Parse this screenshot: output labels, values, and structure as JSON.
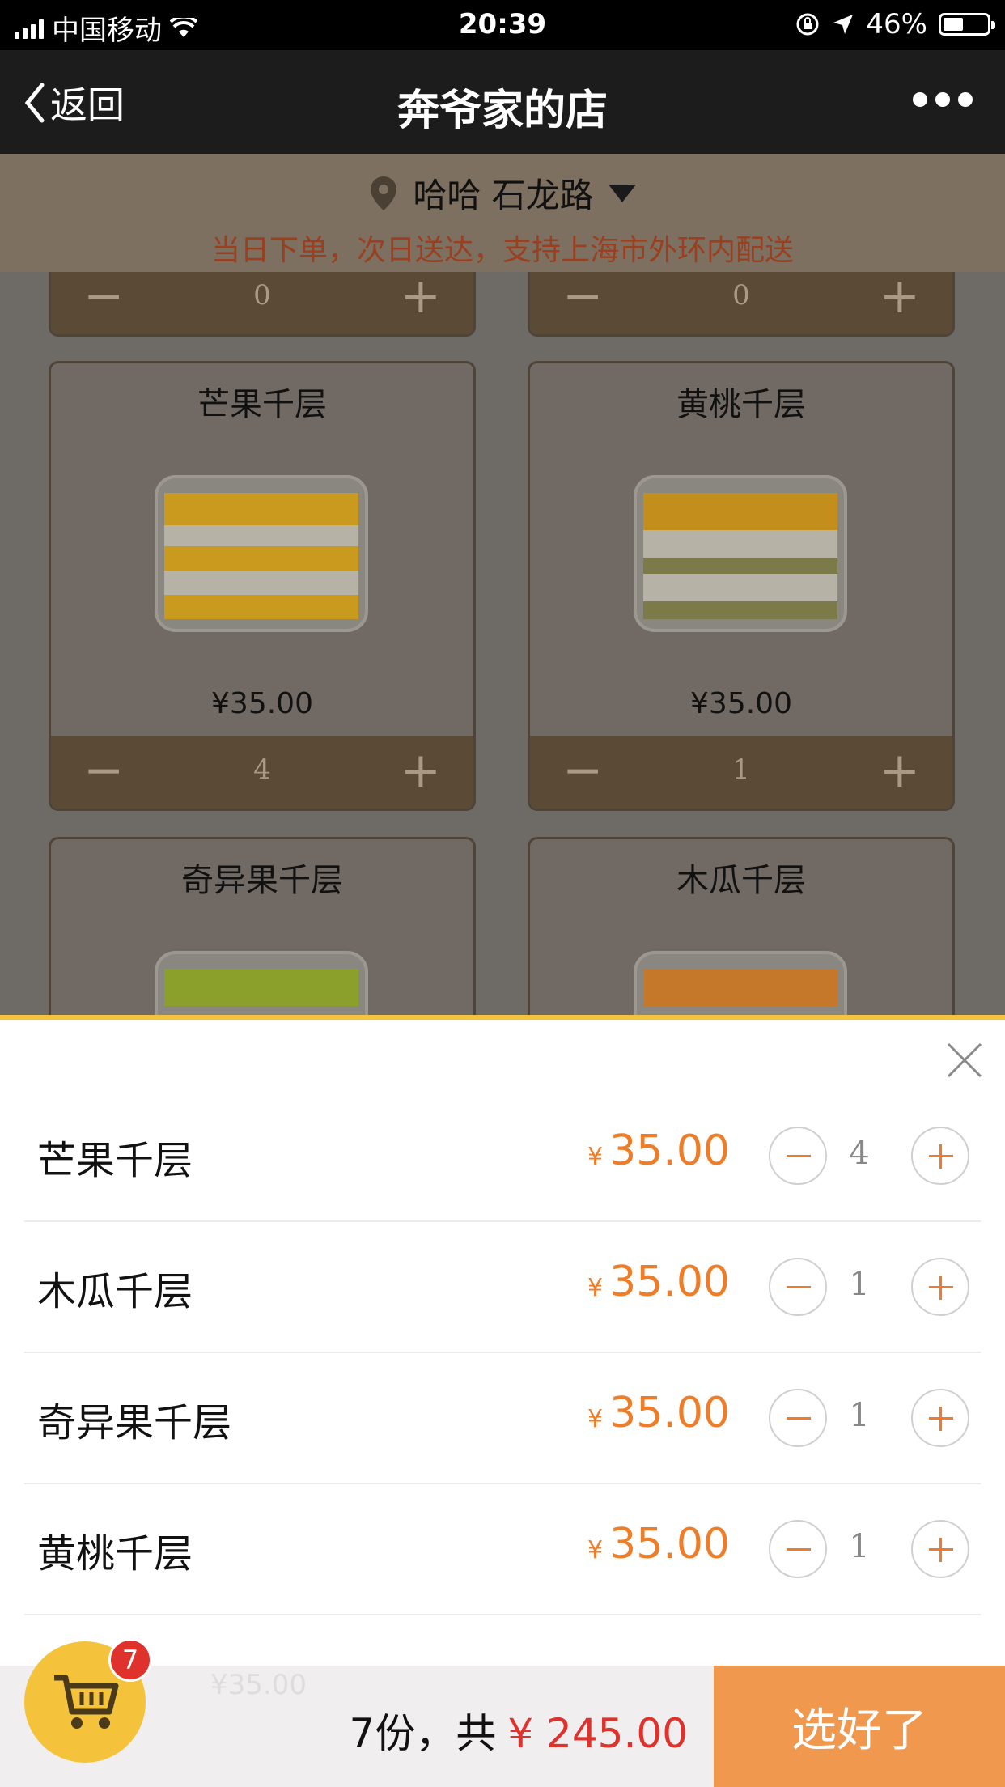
{
  "status_bar": {
    "carrier": "中国移动",
    "time": "20:39",
    "battery": "46%",
    "battery_level": 0.46
  },
  "nav": {
    "back_label": "返回",
    "title": "奔爷家的店"
  },
  "location": {
    "address": "哈哈 石龙路",
    "notice": "当日下单，次日送达，支持上海市外环内配送"
  },
  "products": {
    "top_left_qty": "0",
    "top_right_qty": "0",
    "items": [
      {
        "name": "芒果千层",
        "price": "¥35.00",
        "qty": "4"
      },
      {
        "name": "黄桃千层",
        "price": "¥35.00",
        "qty": "1"
      },
      {
        "name": "奇异果千层"
      },
      {
        "name": "木瓜千层"
      }
    ]
  },
  "cart": {
    "currency": "¥",
    "items": [
      {
        "name": "芒果千层",
        "price": "35.00",
        "qty": "4"
      },
      {
        "name": "木瓜千层",
        "price": "35.00",
        "qty": "1"
      },
      {
        "name": "奇异果千层",
        "price": "35.00",
        "qty": "1"
      },
      {
        "name": "黄桃千层",
        "price": "35.00",
        "qty": "1"
      }
    ],
    "ghost_price": "¥35.00",
    "badge_count": "7",
    "summary_prefix": "7份，共",
    "total": "¥ 245.00",
    "checkout_label": "选好了"
  },
  "colors": {
    "accent_orange": "#ee7d2a",
    "checkout_orange": "#f0984e",
    "cart_yellow": "#f4c23b",
    "total_red": "#e0322c"
  }
}
